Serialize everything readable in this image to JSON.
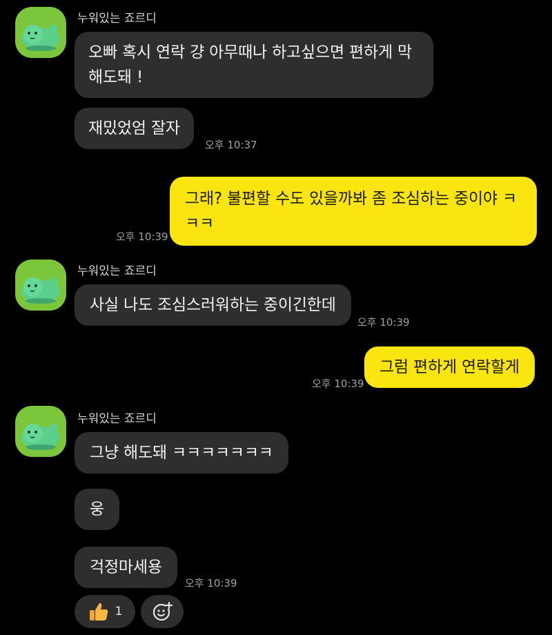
{
  "chat": {
    "sender_name": "누워있는 죠르디",
    "group1": {
      "msg1": "오빠 혹시 연락 걍 아무때나 하고싶으면 편하게 막 해도돼 !",
      "msg2": "재밌었엄 잘자",
      "time": "오후 10:37"
    },
    "mine1": {
      "msg": "그래? 불편할 수도 있을까봐 좀 조심하는 중이야 ㅋㅋㅋ",
      "time": "오후 10:39"
    },
    "group2": {
      "msg": "사실 나도 조심스러워하는 중이긴한데",
      "time": "오후 10:39"
    },
    "mine2": {
      "msg": "그럼 편하게 연락할게",
      "time": "오후 10:39"
    },
    "group3": {
      "msg1": "그냥 해도돼 ㅋㅋㅋㅋㅋㅋㅋ",
      "msg2": "웅",
      "msg3": "걱정마세용",
      "time": "오후 10:39"
    },
    "reactions": {
      "thumbs_count": "1",
      "thumbs_icon": "thumbs-up-icon",
      "add_icon": "add-reaction-icon"
    }
  }
}
